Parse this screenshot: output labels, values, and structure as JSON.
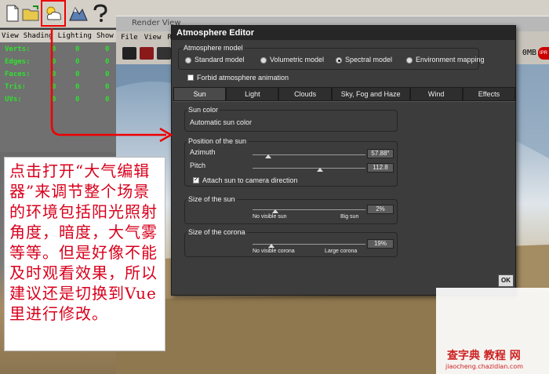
{
  "toolbar": {
    "icons": [
      "new-file-icon",
      "open-folder-icon",
      "atmosphere-editor-icon",
      "terrain-icon",
      "help-icon"
    ],
    "help_glyph": "?"
  },
  "left_panel": {
    "menu": [
      "View",
      "Shading",
      "Lighting",
      "Show"
    ],
    "stats": [
      {
        "label": "Verts:",
        "v1": "0",
        "v2": "0",
        "v3": "0"
      },
      {
        "label": "Edges:",
        "v1": "0",
        "v2": "0",
        "v3": "0"
      },
      {
        "label": "Faces:",
        "v1": "0",
        "v2": "0",
        "v3": "0"
      },
      {
        "label": "Tris:",
        "v1": "0",
        "v2": "0",
        "v3": "0"
      },
      {
        "label": "UVs:",
        "v1": "0",
        "v2": "0",
        "v3": "0"
      }
    ]
  },
  "render_view": {
    "title": "Render View",
    "menu": [
      "File",
      "View",
      "Re"
    ],
    "memory": "R: 0MB",
    "ipr": "IPR"
  },
  "annotation": {
    "text": "点击打开“大气编辑器”来调节整个场景的环境包括阳光照射角度，暗度，大气雾等等。但是好像不能及时观看效果，所以建议还是切换到Vue里进行修改。",
    "color": "#d8001c"
  },
  "dialog": {
    "title": "Atmosphere Editor",
    "atmosphere_model_label": "Atmosphere model",
    "models": [
      {
        "label": "Standard model",
        "selected": false
      },
      {
        "label": "Volumetric model",
        "selected": false
      },
      {
        "label": "Spectral model",
        "selected": true
      },
      {
        "label": "Environment mapping",
        "selected": false
      }
    ],
    "forbid_label": "Forbid atmosphere animation",
    "forbid_checked": false,
    "tabs": [
      {
        "label": "Sun",
        "active": true
      },
      {
        "label": "Light",
        "active": false
      },
      {
        "label": "Clouds",
        "active": false
      },
      {
        "label": "Sky, Fog and Haze",
        "active": false
      },
      {
        "label": "Wind",
        "active": false
      },
      {
        "label": "Effects",
        "active": false
      }
    ],
    "sun_color": {
      "group_label": "Sun color",
      "value": "Automatic sun color"
    },
    "position": {
      "group_label": "Position of the sun",
      "azimuth_label": "Azimuth",
      "azimuth_value": "57.88°",
      "azimuth_fraction": 0.14,
      "pitch_label": "Pitch",
      "pitch_value": "112.8",
      "pitch_fraction": 0.6,
      "attach_label": "Attach sun to camera direction",
      "attach_checked": true
    },
    "size_sun": {
      "group_label": "Size of the sun",
      "min_label": "No visible sun",
      "max_label": "Big sun",
      "value": "2%",
      "fraction": 0.2
    },
    "size_corona": {
      "group_label": "Size of the corona",
      "min_label": "No visible corona",
      "max_label": "Large corona",
      "value": "19%",
      "fraction": 0.17
    },
    "ok_label": "OK"
  },
  "watermark": {
    "main": "查字典 教程 网",
    "sub": "jiaocheng.chazidian.com"
  }
}
